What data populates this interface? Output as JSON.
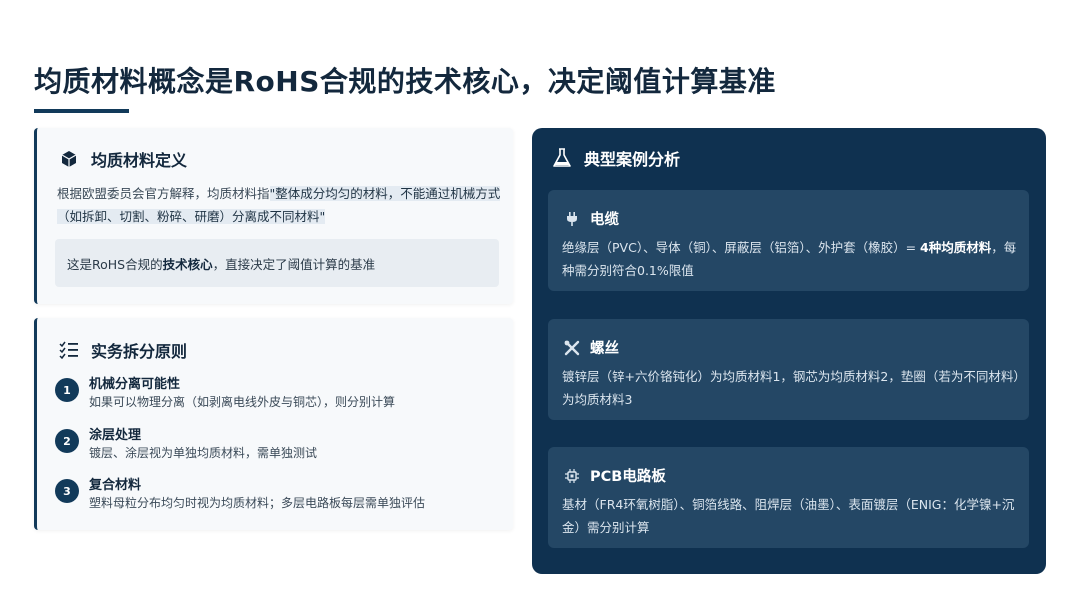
{
  "title": "均质材料概念是RoHS合规的技术核心，决定阈值计算基准",
  "definition": {
    "heading": "均质材料定义",
    "icon": "cube-icon",
    "text_prefix": "根据欧盟委员会官方解释，均质材料指",
    "quote": "\"整体成分均匀的材料，不能通过机械方式（如拆卸、切割、粉碎、研磨）分离成不同材料\"",
    "note_prefix": "这是RoHS合规的",
    "note_bold": "技术核心",
    "note_suffix": "，直接决定了阈值计算的基准"
  },
  "rules": {
    "heading": "实务拆分原则",
    "icon": "checklist-icon",
    "items": [
      {
        "num": "1",
        "title": "机械分离可能性",
        "desc": "如果可以物理分离（如剥离电线外皮与铜芯），则分别计算"
      },
      {
        "num": "2",
        "title": "涂层处理",
        "desc": "镀层、涂层视为单独均质材料，需单独测试"
      },
      {
        "num": "3",
        "title": "复合材料",
        "desc": "塑料母粒分布均匀时视为均质材料；多层电路板每层需单独评估"
      }
    ]
  },
  "cases": {
    "heading": "典型案例分析",
    "icon": "flask-icon",
    "items": [
      {
        "icon": "plug-icon",
        "title": "电缆",
        "text": "绝缘层（PVC）、导体（铜）、屏蔽层（铝箔）、外护套（橡胶）= ",
        "bold": "4种均质材料",
        "suffix": "，每种需分别符合0.1%限值"
      },
      {
        "icon": "tools-icon",
        "title": "螺丝",
        "text": "镀锌层（锌+六价铬钝化）为均质材料1，钢芯为均质材料2，垫圈（若为不同材料）为均质材料3",
        "bold": "",
        "suffix": ""
      },
      {
        "icon": "chip-icon",
        "title": "PCB电路板",
        "text": "基材（FR4环氧树脂）、铜箔线路、阻焊层（油墨）、表面镀层（ENIG：化学镍+沉金）需分别计算",
        "bold": "",
        "suffix": ""
      }
    ]
  },
  "colors": {
    "primary": "#123a5a",
    "panel": "#0f3150",
    "case_card": "#244765"
  }
}
